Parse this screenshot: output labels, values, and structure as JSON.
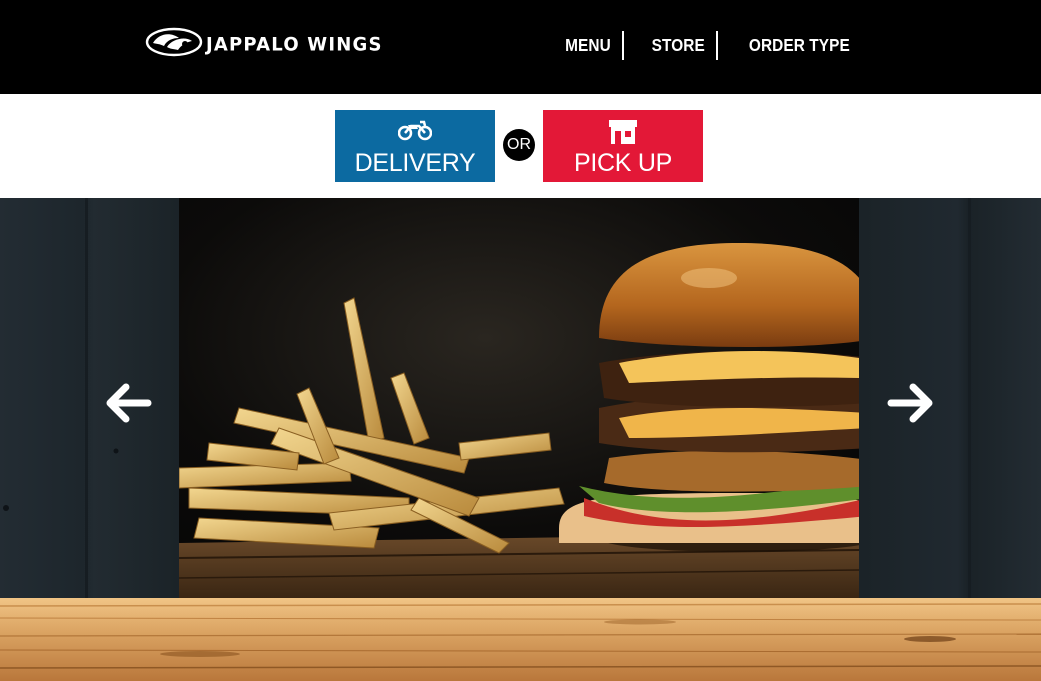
{
  "header": {
    "brand": "JAPPALO WINGS",
    "logo_icon": "wing-logo-icon",
    "nav": [
      {
        "label": "MENU"
      },
      {
        "label": "STORE"
      },
      {
        "label": "ORDER TYPE"
      }
    ]
  },
  "order_type": {
    "delivery": {
      "label": "DELIVERY",
      "icon": "motorbike-icon",
      "color": "#0c6aa1"
    },
    "or_label": "OR",
    "pickup": {
      "label": "PICK UP",
      "icon": "store-icon",
      "color": "#e31837"
    }
  },
  "carousel": {
    "prev_icon": "arrow-left-icon",
    "next_icon": "arrow-right-icon",
    "slide": "burger-and-fries-photo"
  },
  "colors": {
    "header_bg": "#000000",
    "delivery_blue": "#0c6aa1",
    "pickup_red": "#e31837",
    "wood": "#d9a56a"
  }
}
